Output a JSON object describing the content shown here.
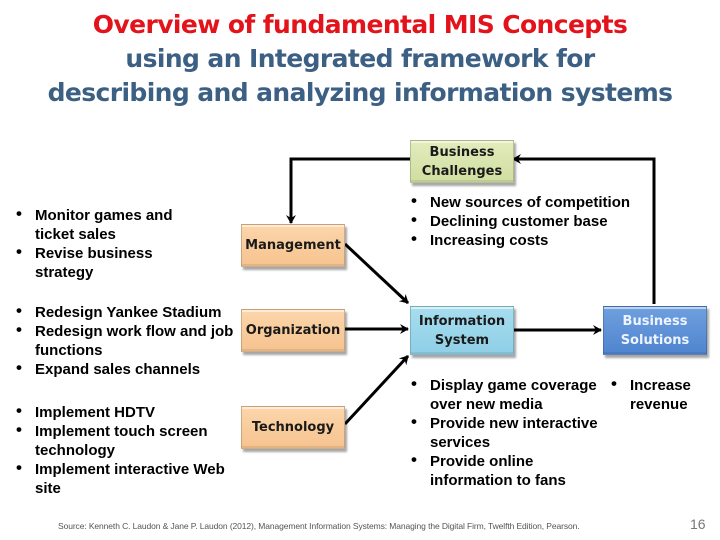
{
  "title": {
    "line1": "Overview of fundamental MIS Concepts",
    "line2": "using an Integrated framework for",
    "line3": "describing and analyzing information systems"
  },
  "colors": {
    "title_accent": "#e3131b",
    "title_secondary": "#3c5f84",
    "business_challenges_box": "#d8e4ae",
    "dimension_boxes": "#f9cc9c",
    "information_system_box": "#9bd6eb",
    "business_solutions_box": "#5b8fd5"
  },
  "boxes": {
    "business_challenges": "Business Challenges",
    "management": "Management",
    "organization": "Organization",
    "technology": "Technology",
    "information_system": "Information System",
    "business_solutions": "Business Solutions"
  },
  "left_lists": {
    "management": [
      "Monitor games and ticket sales",
      "Revise business strategy"
    ],
    "organization": [
      "Redesign Yankee Stadium",
      "Redesign work flow and job functions",
      "Expand sales channels"
    ],
    "technology": [
      "Implement HDTV",
      "Implement touch screen technology",
      "Implement interactive Web site"
    ]
  },
  "challenges_list": [
    "New sources of competition",
    "Declining customer base",
    "Increasing costs"
  ],
  "information_system_list": [
    "Display game coverage over new media",
    "Provide new interactive services",
    "Provide online information to fans"
  ],
  "solutions_list": [
    "Increase revenue"
  ],
  "footer": {
    "source": "Source: Kenneth C. Laudon & Jane P. Laudon (2012),  Management Information Systems: Managing the Digital Firm, Twelfth Edition, Pearson.",
    "page_number": "16"
  }
}
